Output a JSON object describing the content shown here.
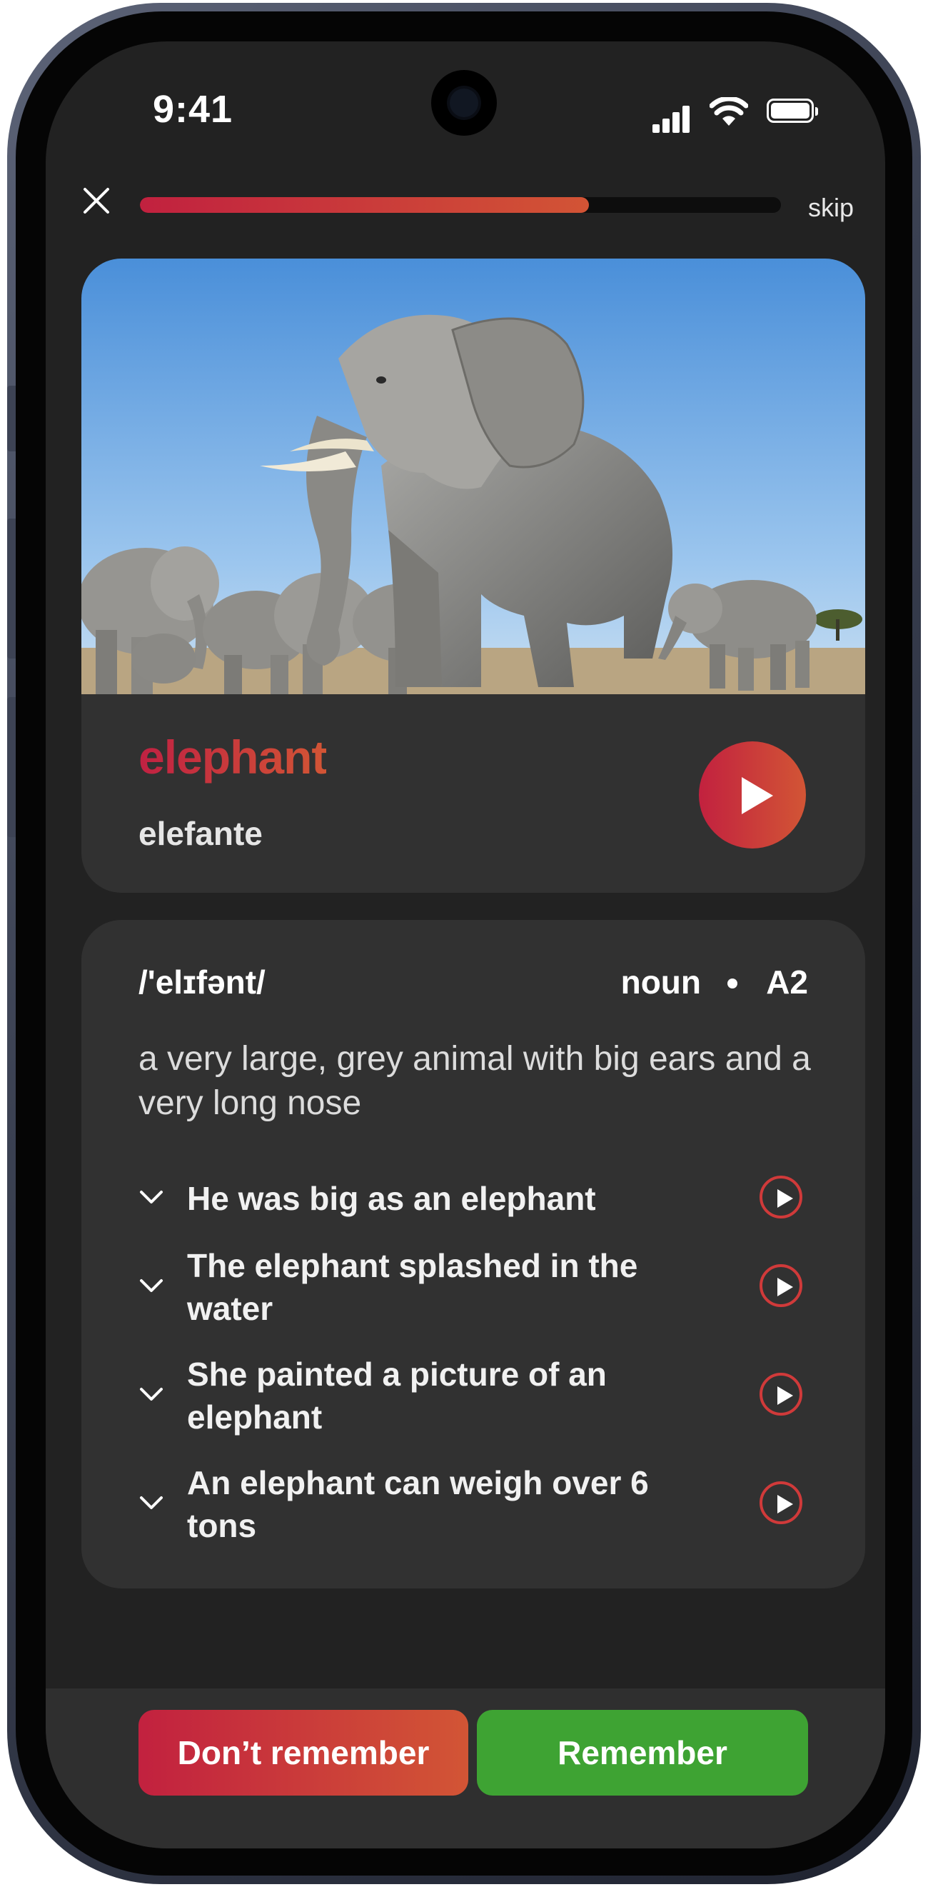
{
  "status_bar": {
    "time": "9:41"
  },
  "top_bar": {
    "progress": 0.7,
    "skip_label": "skip"
  },
  "card": {
    "word": "elephant",
    "translation": "elefante",
    "image": "photo of elephants on savanna under blue sky"
  },
  "details": {
    "phonetic": "/'elɪfənt/",
    "part_of_speech": "noun",
    "level": "A2",
    "definition": "a very large, grey animal with big ears and a very long nose",
    "examples": [
      {
        "text": "He was big as an elephant"
      },
      {
        "text": "The elephant splashed in the water"
      },
      {
        "text": "She painted a picture of an elephant"
      },
      {
        "text": "An elephant can weigh over 6 tons"
      }
    ]
  },
  "actions": {
    "forgot_label": "Don’t remember",
    "remember_label": "Remember"
  },
  "colors": {
    "accent_start": "#c2213f",
    "accent_end": "#d25535",
    "remember": "#3ea333",
    "background": "#222222",
    "card": "#313131"
  }
}
